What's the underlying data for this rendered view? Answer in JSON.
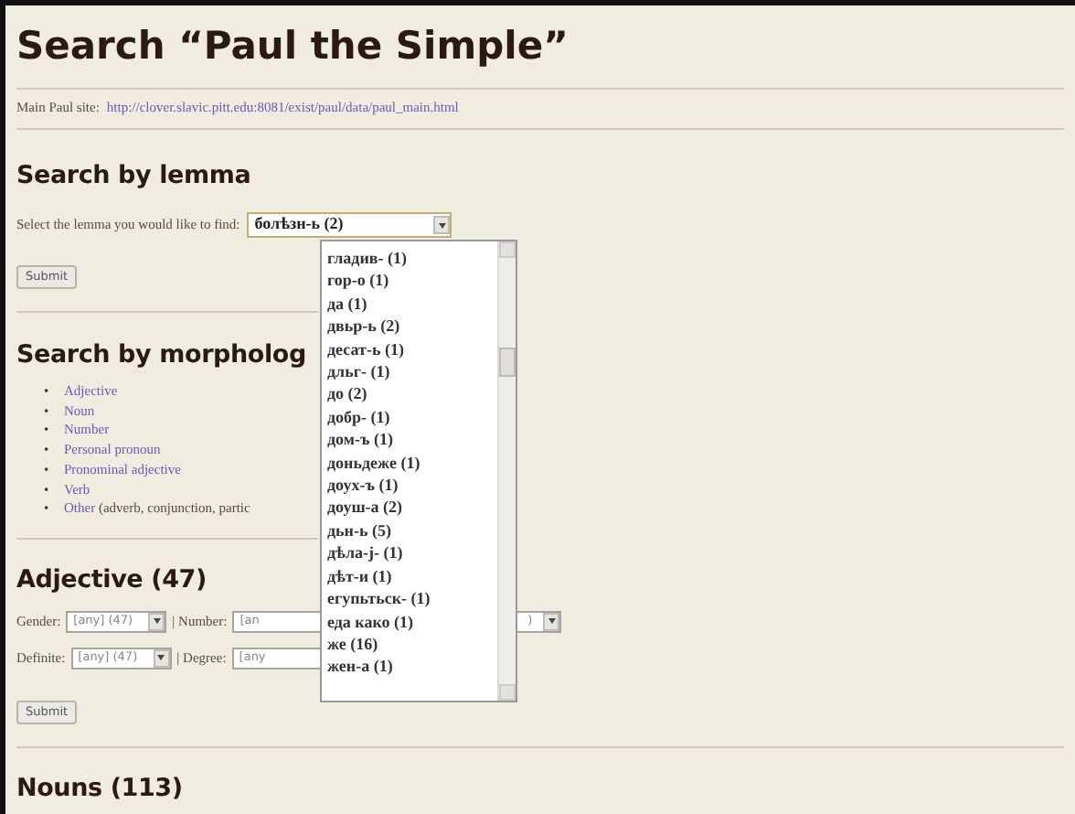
{
  "title": "Search “Paul the Simple”",
  "main_site": {
    "label": "Main Paul site:",
    "url": "http://clover.slavic.pitt.edu:8081/exist/paul/data/paul_main.html"
  },
  "lemma_section": {
    "heading": "Search by lemma",
    "prompt": "Select the lemma you would like to find:",
    "selected_value": "болѣзн-ь (2)",
    "submit": "Submit",
    "dropdown": {
      "expanded": true,
      "options": [
        {
          "label": "гладив- (1)"
        },
        {
          "label": "гор-о (1)"
        },
        {
          "label": "да (1)"
        },
        {
          "label": "двьр-ь (2)"
        },
        {
          "label": "десат-ь (1)"
        },
        {
          "label": "дльг- (1)"
        },
        {
          "label": "до (2)"
        },
        {
          "label": "добр- (1)"
        },
        {
          "label": "дом-ъ (1)"
        },
        {
          "label": "доньдеже (1)"
        },
        {
          "label": "доух-ъ (1)"
        },
        {
          "label": "доуш-а (2)"
        },
        {
          "label": "дьн-ь (5)"
        },
        {
          "label": "дѣла-j- (1)"
        },
        {
          "label": "дѣт-и (1)"
        },
        {
          "label": "егупьтьск- (1)"
        },
        {
          "label": "еда како (1)"
        },
        {
          "label": "же (16)"
        },
        {
          "label": "жен-а (1)"
        }
      ]
    }
  },
  "morphology": {
    "heading": "Search by morpholog",
    "links": [
      {
        "marker": "•",
        "label": "Adjective"
      },
      {
        "marker": "•",
        "label": "Noun"
      },
      {
        "marker": "•",
        "label": "Number"
      },
      {
        "marker": "•",
        "label": "Personal pronoun"
      },
      {
        "marker": "•",
        "label": "Pronominal adjective"
      },
      {
        "marker": "•",
        "label": "Verb"
      },
      {
        "marker": "•",
        "label": "Other",
        "note": "(adverb, conjunction, partic"
      }
    ]
  },
  "adjective": {
    "heading": "Adjective (47)",
    "rows": [
      [
        {
          "label": "Gender:",
          "value": "[any] (47)"
        },
        {
          "label": "| Number:",
          "value": "[an",
          "value_end": ")"
        }
      ],
      [
        {
          "label": "Definite:",
          "value": "[any] (47)"
        },
        {
          "label": "| Degree:",
          "value": "[any"
        }
      ]
    ],
    "submit": "Submit"
  },
  "nouns": {
    "heading": "Nouns (113)"
  }
}
